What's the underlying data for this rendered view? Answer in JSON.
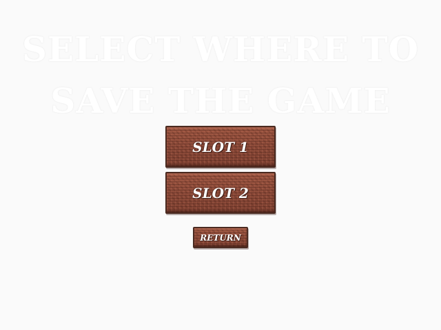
{
  "title": {
    "line1": "SELECT WHERE TO",
    "line2": "SAVE THE GAME"
  },
  "buttons": {
    "slot1": "SLOT 1",
    "slot2": "SLOT 2",
    "return": "RETURN"
  },
  "colors": {
    "background": "#fafafa",
    "title": "#ffffff",
    "plank": "#8a4a38",
    "plank_border": "#4a2a20",
    "label": "#ffffff"
  }
}
